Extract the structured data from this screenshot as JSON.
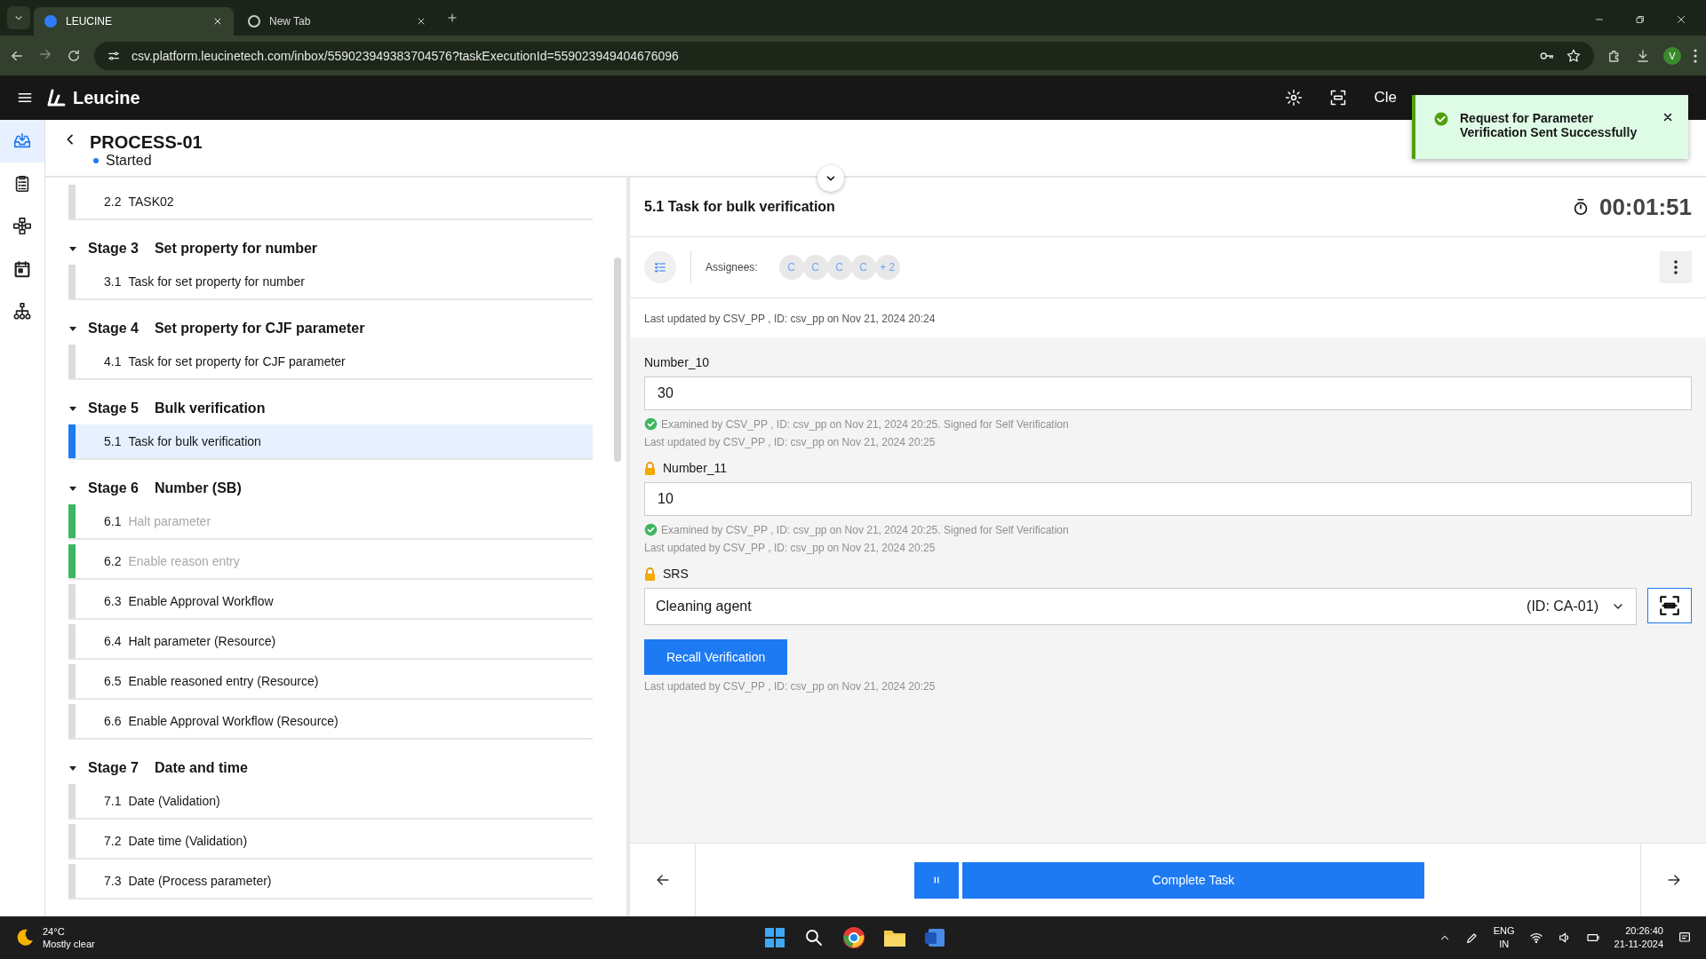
{
  "browser": {
    "tabs": [
      {
        "title": "LEUCINE",
        "selected": true
      },
      {
        "title": "New Tab",
        "selected": false
      }
    ],
    "url": "csv.platform.leucinetech.com/inbox/559023949383704576?taskExecutionId=559023949404676096",
    "profile_initial": "V"
  },
  "app": {
    "brand": "Leucine",
    "header_text": "Cle"
  },
  "toast": {
    "message": "Request for Parameter Verification Sent Successfully"
  },
  "nav_rail": [
    {
      "kind": "inbox",
      "selected": true
    },
    {
      "kind": "checklist",
      "selected": false
    },
    {
      "kind": "flow",
      "selected": false
    },
    {
      "kind": "calendar",
      "selected": false
    },
    {
      "kind": "hierarchy",
      "selected": false
    }
  ],
  "process": {
    "title": "PROCESS-01",
    "status": "Started"
  },
  "stages": [
    {
      "tasks": [
        {
          "number": "2.2",
          "name": "TASK02",
          "completed": false,
          "selected": false
        }
      ]
    },
    {
      "stage": "Stage 3",
      "name": "Set property for number",
      "expanded": true,
      "tasks": [
        {
          "number": "3.1",
          "name": "Task for set property for number",
          "completed": false,
          "selected": false
        }
      ]
    },
    {
      "stage": "Stage 4",
      "name": "Set property for CJF parameter",
      "expanded": true,
      "tasks": [
        {
          "number": "4.1",
          "name": "Task for set property for CJF parameter",
          "completed": false,
          "selected": false
        }
      ]
    },
    {
      "stage": "Stage 5",
      "name": "Bulk verification",
      "expanded": true,
      "tasks": [
        {
          "number": "5.1",
          "name": "Task for bulk verification",
          "completed": false,
          "selected": true
        }
      ]
    },
    {
      "stage": "Stage 6",
      "name": "Number (SB)",
      "expanded": true,
      "tasks": [
        {
          "number": "6.1",
          "name": "Halt parameter",
          "completed": true,
          "selected": false
        },
        {
          "number": "6.2",
          "name": "Enable reason entry",
          "completed": true,
          "selected": false
        },
        {
          "number": "6.3",
          "name": "Enable Approval Workflow",
          "completed": false,
          "selected": false
        },
        {
          "number": "6.4",
          "name": "Halt parameter (Resource)",
          "completed": false,
          "selected": false
        },
        {
          "number": "6.5",
          "name": "Enable reasoned entry (Resource)",
          "completed": false,
          "selected": false
        },
        {
          "number": "6.6",
          "name": "Enable Approval Workflow (Resource)",
          "completed": false,
          "selected": false
        }
      ]
    },
    {
      "stage": "Stage 7",
      "name": "Date and time",
      "expanded": true,
      "tasks": [
        {
          "number": "7.1",
          "name": "Date (Validation)",
          "completed": false,
          "selected": false
        },
        {
          "number": "7.2",
          "name": "Date time (Validation)",
          "completed": false,
          "selected": false
        },
        {
          "number": "7.3",
          "name": "Date (Process parameter)",
          "completed": false,
          "selected": false
        }
      ]
    }
  ],
  "task": {
    "title": "5.1 Task for bulk verification",
    "timer": "00:01:51",
    "assignees_label": "Assignees:",
    "assignees": [
      "C",
      "C",
      "C",
      "C",
      "+ 2"
    ],
    "last_updated": "Last updated by CSV_PP , ID: csv_pp on Nov 21, 2024 20:24"
  },
  "parameters": [
    {
      "kind": "number",
      "label": "Number_10",
      "locked": false,
      "value": "30",
      "verification": "Examined by CSV_PP , ID: csv_pp on Nov 21, 2024 20:25. Signed for Self Verification",
      "last_updated": "Last updated by CSV_PP , ID: csv_pp on Nov 21, 2024 20:25"
    },
    {
      "kind": "number",
      "label": "Number_11",
      "locked": true,
      "value": "10",
      "verification": "Examined by CSV_PP , ID: csv_pp on Nov 21, 2024 20:25. Signed for Self Verification",
      "last_updated": "Last updated by CSV_PP , ID: csv_pp on Nov 21, 2024 20:25"
    },
    {
      "kind": "resource",
      "label": "SRS",
      "locked": true,
      "value": "Cleaning agent",
      "id_text": "(ID: CA-01)",
      "action": "Recall Verification",
      "last_updated": "Last updated by CSV_PP , ID: csv_pp on Nov 21, 2024 20:25"
    }
  ],
  "footer": {
    "complete_label": "Complete Task"
  },
  "taskbar": {
    "temperature": "24°C",
    "weather": "Mostly clear",
    "lang": "ENG",
    "region": "IN",
    "time": "20:26:40",
    "date": "21-11-2024"
  }
}
